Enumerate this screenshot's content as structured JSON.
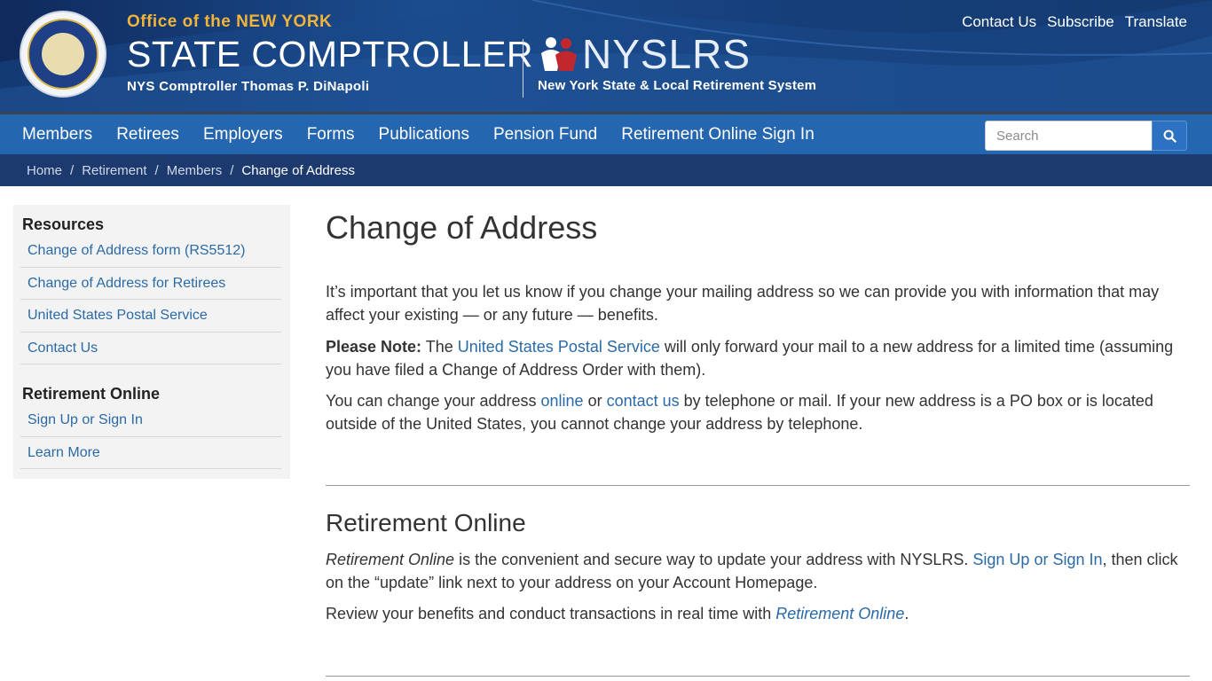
{
  "header": {
    "office_line": "Office of the NEW YORK",
    "title": "STATE COMPTROLLER",
    "subtitle": "NYS Comptroller Thomas P. DiNapoli",
    "nyslrs_logo": "NYSLRS",
    "nyslrs_subtitle": "New York State & Local Retirement System",
    "seal_icon": "new-york-state-seal-icon",
    "utility_links": [
      "Contact Us",
      "Subscribe",
      "Translate"
    ]
  },
  "nav": {
    "items": [
      "Members",
      "Retirees",
      "Employers",
      "Forms",
      "Publications",
      "Pension Fund",
      "Retirement Online Sign In"
    ],
    "search_placeholder": "Search",
    "search_icon": "search-icon"
  },
  "breadcrumb": {
    "items": [
      "Home",
      "Retirement",
      "Members"
    ],
    "current": "Change of Address",
    "separator": "/"
  },
  "sidebar": {
    "resources_heading": "Resources",
    "resources": [
      "Change of Address form (RS5512)",
      "Change of Address for Retirees",
      "United States Postal Service",
      "Contact Us"
    ],
    "ro_heading": "Retirement Online",
    "ro_links": [
      "Sign Up or Sign In",
      "Learn More"
    ]
  },
  "main": {
    "title": "Change of Address",
    "p1": "It’s important that you let us know if you change your mailing address so we can provide you with information that may affect your existing — or any future — benefits.",
    "p2_label": "Please Note:",
    "p2_pre": " The ",
    "p2_link": "United States Postal Service",
    "p2_post": " will only forward your mail to a new address for a limited time (assuming you have filed a Change of Address Order with them).",
    "p3_pre": "You can change your address ",
    "p3_link1": "online",
    "p3_mid": " or ",
    "p3_link2": "contact us",
    "p3_post": " by telephone or mail. If your new address is a PO box or is located outside of the United States, you cannot change your address by telephone.",
    "section_title": "Retirement Online",
    "p4_em": "Retirement Online",
    "p4_mid": " is the convenient and secure way to update your address with NYSLRS. ",
    "p4_link": "Sign Up or Sign In",
    "p4_post": ", then click on the “update” link next to your address on your Account Homepage.",
    "p5_pre": "Review your benefits and conduct transactions in real time with ",
    "p5_link": "Retirement Online",
    "p5_post": "."
  },
  "colors": {
    "header_blue": "#163f7a",
    "nav_blue": "#2566b0",
    "breadcrumb_blue": "#1c3a6e",
    "accent_gold": "#f0b43a",
    "link_blue": "#2a6aa6"
  }
}
